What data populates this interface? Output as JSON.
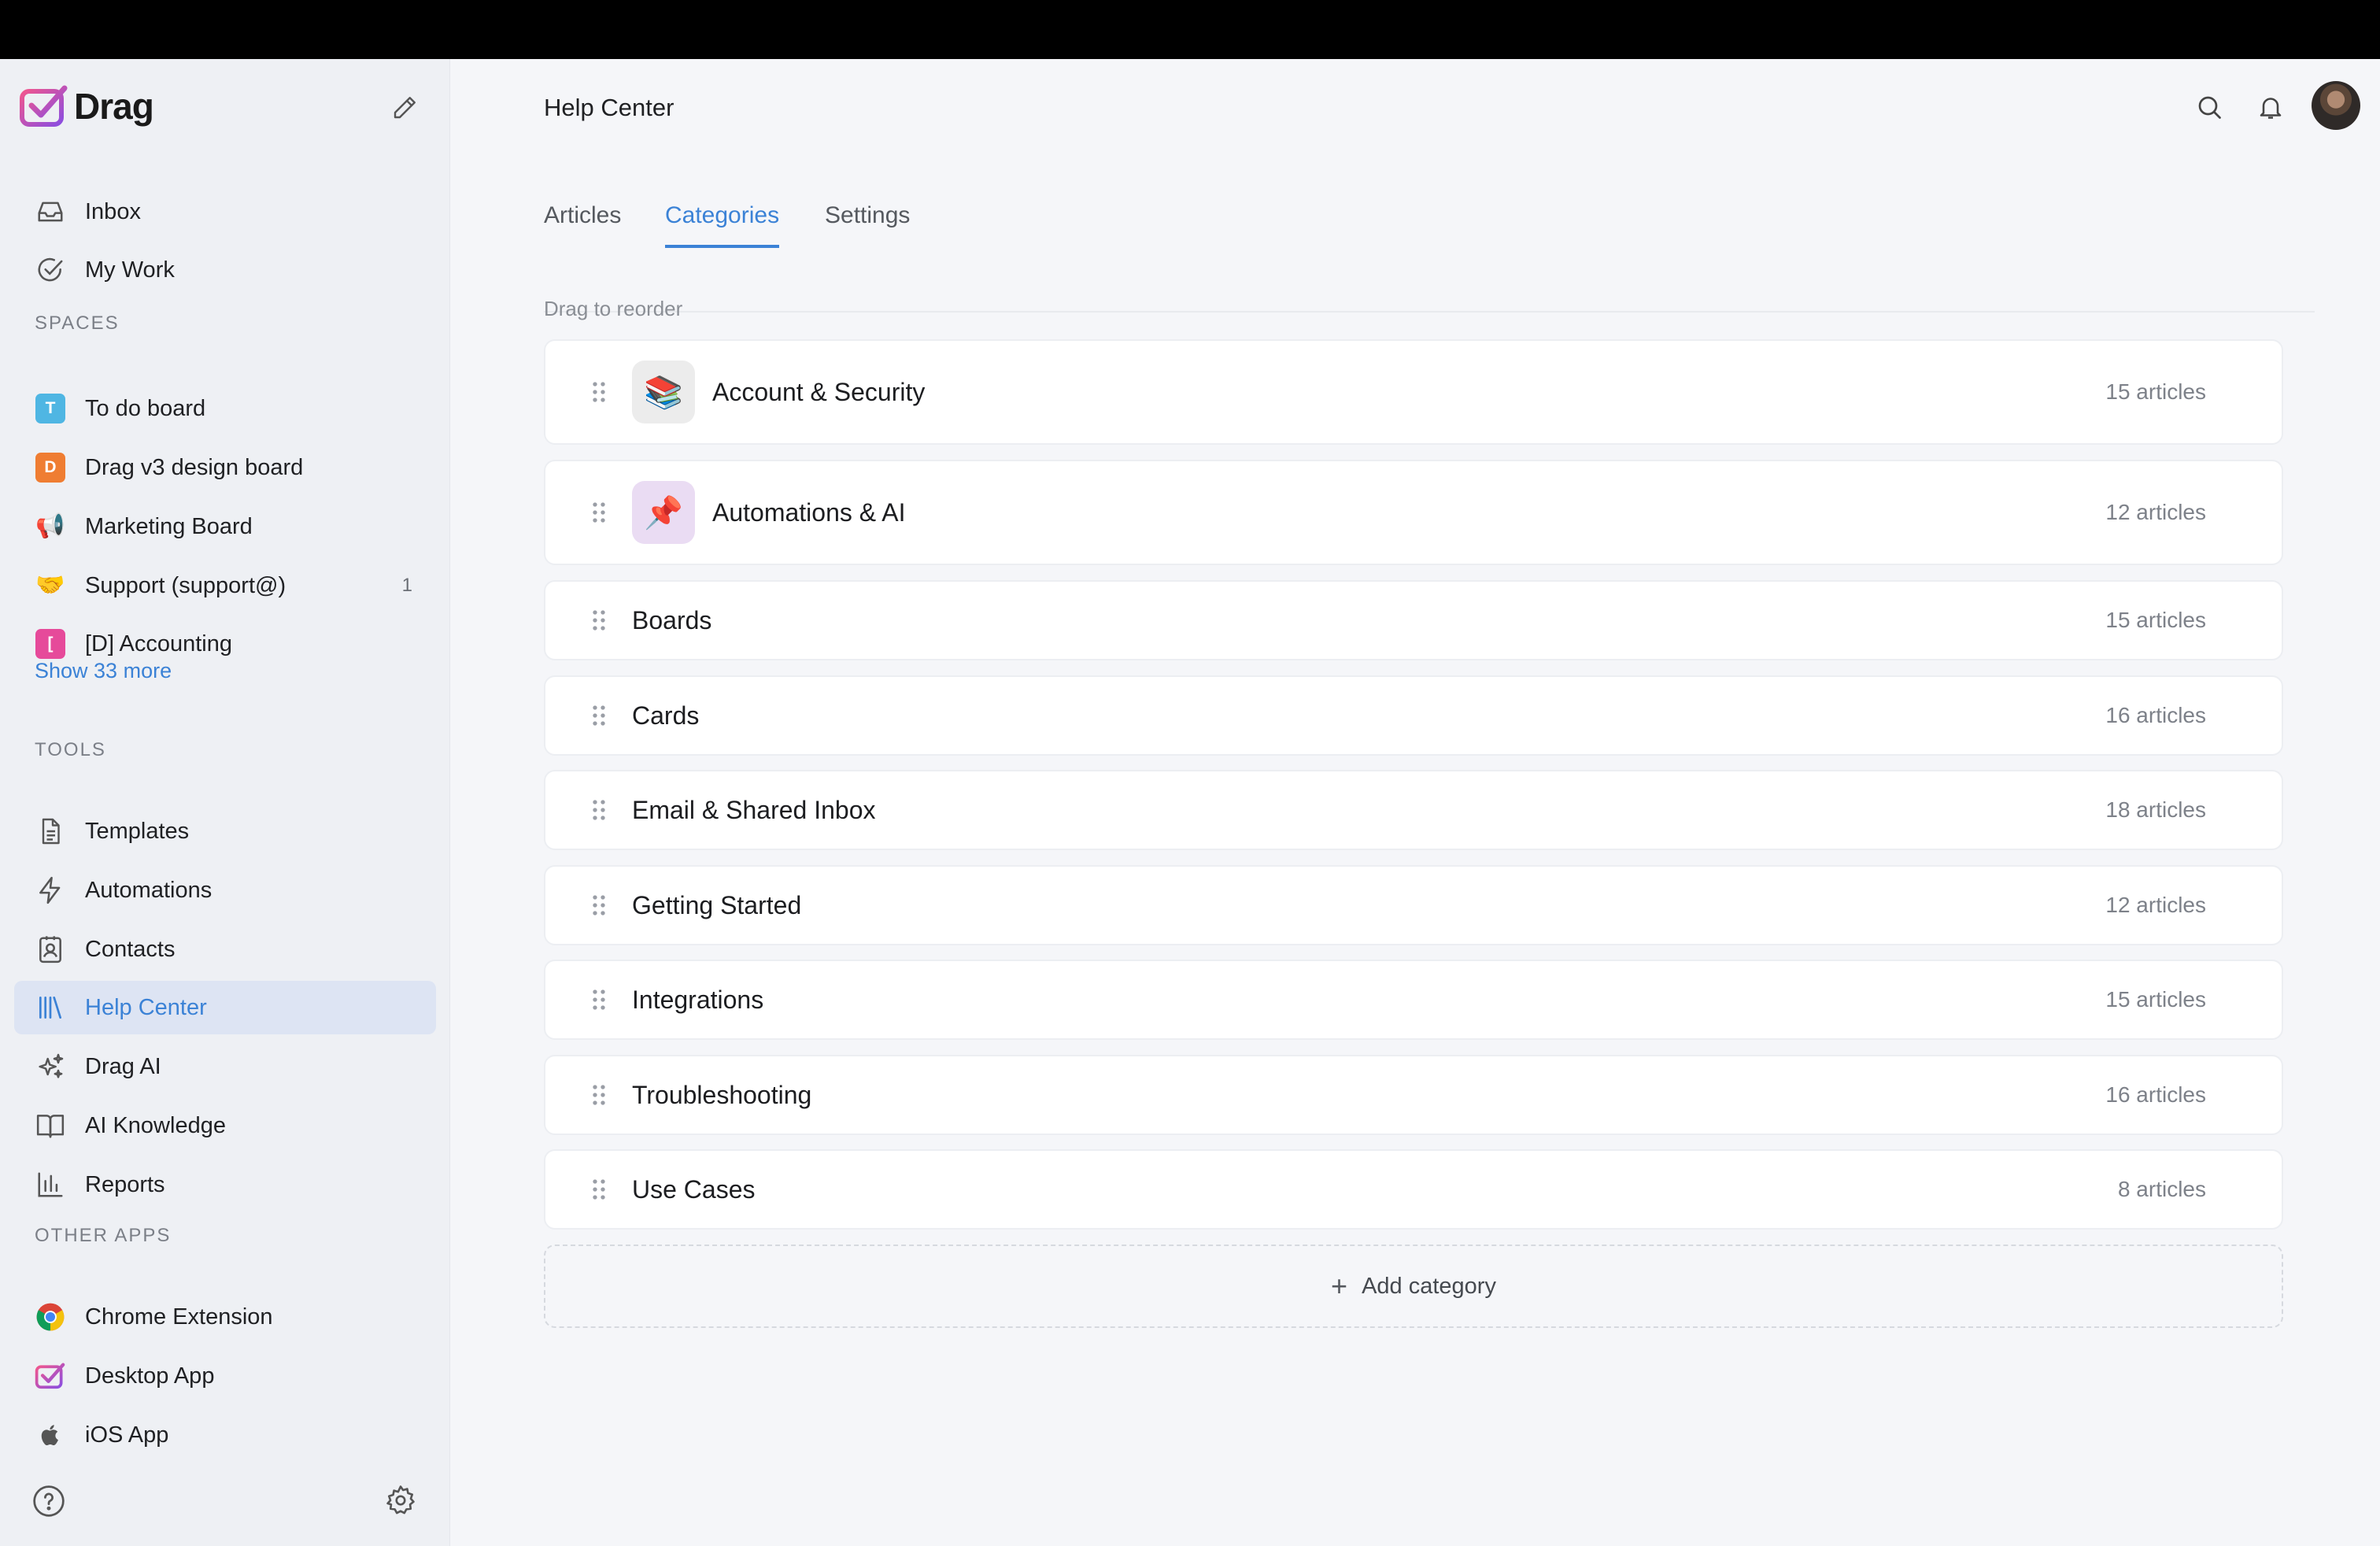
{
  "brand": {
    "name": "Drag"
  },
  "sidebar": {
    "main_items": [
      {
        "label": "Inbox",
        "icon": "inbox-icon"
      },
      {
        "label": "My Work",
        "icon": "check-circle-icon"
      }
    ],
    "spaces_label": "SPACES",
    "spaces": [
      {
        "label": "To do board",
        "badge": "T",
        "color": "#4fb6e3"
      },
      {
        "label": "Drag v3 design board",
        "badge": "D",
        "color": "#ef7d32"
      },
      {
        "label": "Marketing Board",
        "emoji": "📢"
      },
      {
        "label": "Support (support@)",
        "emoji": "🤝",
        "count": "1"
      },
      {
        "label": "[D] Accounting",
        "badge": "[",
        "color": "#e64a9a"
      }
    ],
    "show_more": "Show 33 more",
    "tools_label": "TOOLS",
    "tools": [
      {
        "label": "Templates",
        "icon": "document-icon"
      },
      {
        "label": "Automations",
        "icon": "lightning-icon"
      },
      {
        "label": "Contacts",
        "icon": "contacts-icon"
      },
      {
        "label": "Help Center",
        "icon": "library-icon",
        "active": true
      },
      {
        "label": "Drag AI",
        "icon": "sparkles-icon"
      },
      {
        "label": "AI Knowledge",
        "icon": "book-icon"
      },
      {
        "label": "Reports",
        "icon": "bar-chart-icon"
      }
    ],
    "other_label": "OTHER APPS",
    "other_apps": [
      {
        "label": "Chrome Extension",
        "icon": "chrome-icon"
      },
      {
        "label": "Desktop App",
        "icon": "drag-logo-icon"
      },
      {
        "label": "iOS App",
        "icon": "apple-icon"
      }
    ]
  },
  "header": {
    "title": "Help Center"
  },
  "tabs": [
    {
      "label": "Articles"
    },
    {
      "label": "Categories",
      "active": true
    },
    {
      "label": "Settings"
    }
  ],
  "hint": "Drag to reorder",
  "categories": [
    {
      "name": "Account & Security",
      "count": "15 articles",
      "emoji": "📚",
      "icon_bg": "#ececec"
    },
    {
      "name": "Automations & AI",
      "count": "12 articles",
      "emoji": "📌",
      "icon_bg": "#eadcf3"
    },
    {
      "name": "Boards",
      "count": "15 articles"
    },
    {
      "name": "Cards",
      "count": "16 articles"
    },
    {
      "name": "Email & Shared Inbox",
      "count": "18 articles"
    },
    {
      "name": "Getting Started",
      "count": "12 articles"
    },
    {
      "name": "Integrations",
      "count": "15 articles"
    },
    {
      "name": "Troubleshooting",
      "count": "16 articles"
    },
    {
      "name": "Use Cases",
      "count": "8 articles"
    }
  ],
  "add_category": "Add category",
  "colors": {
    "accent": "#3b82d6",
    "active_bg": "#dde4f3"
  }
}
